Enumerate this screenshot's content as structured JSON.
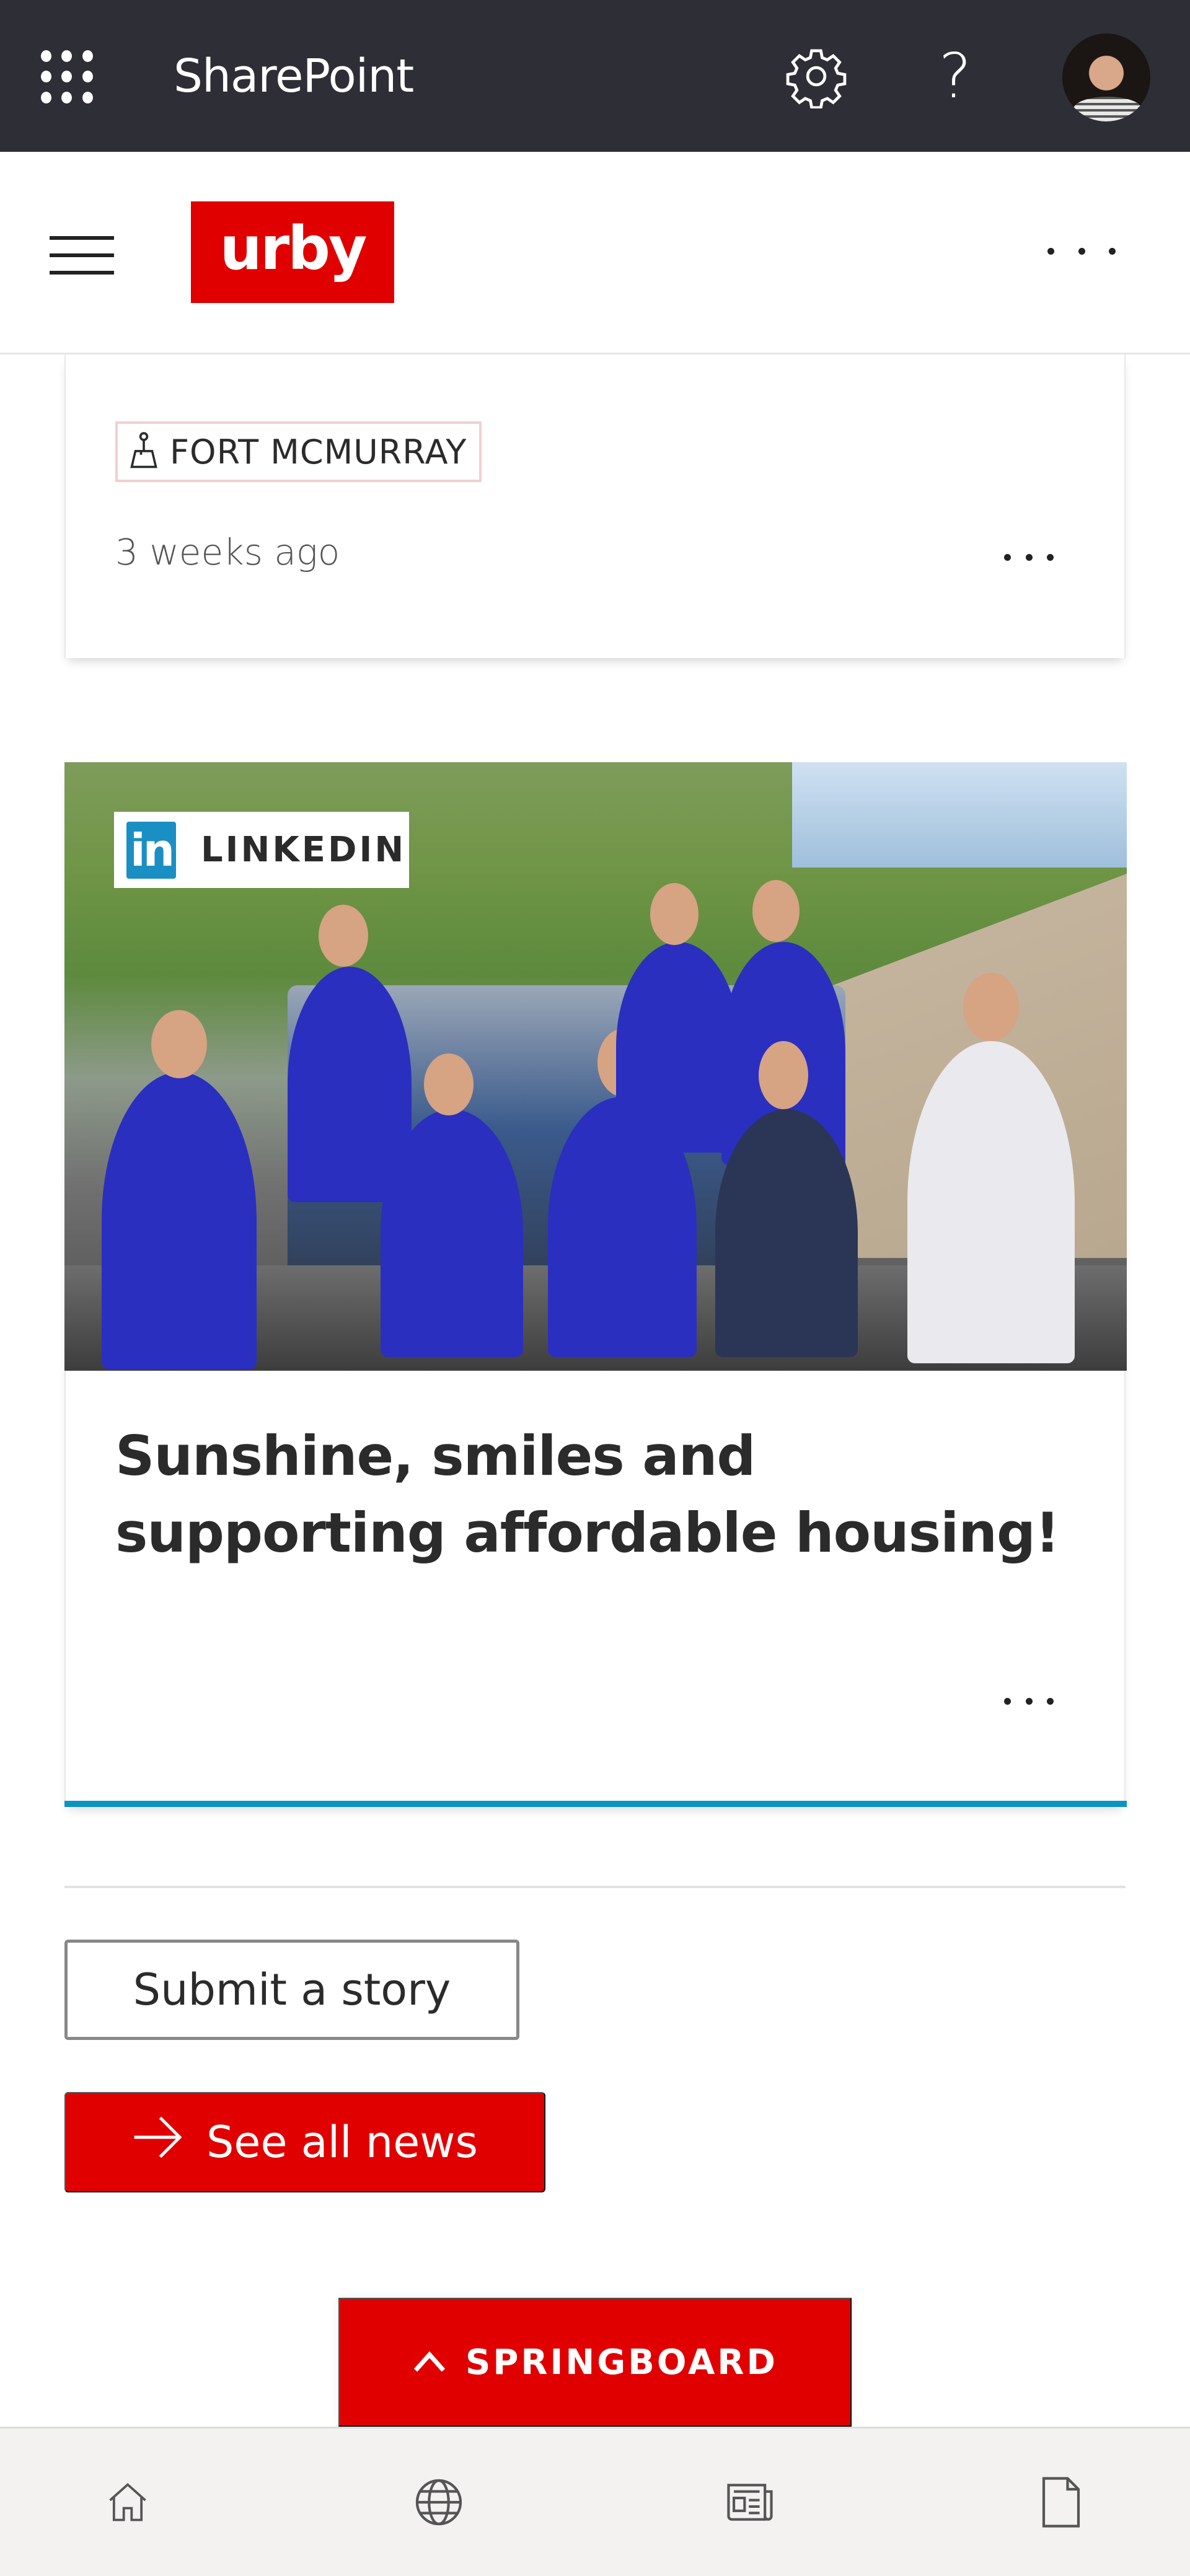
{
  "suite_bar": {
    "app_title": "SharePoint",
    "icons": [
      "app-launcher-icon",
      "settings-gear-icon",
      "help-icon",
      "user-avatar"
    ]
  },
  "site_header": {
    "logo_text": "urby",
    "menu_icon": "hamburger-menu-icon",
    "more_icon": "more-ellipsis-icon"
  },
  "news": {
    "cards": [
      {
        "tag": "FORT MCMURRAY",
        "tag_icon": "location-pin-icon",
        "date": "3 weeks ago"
      },
      {
        "source_badge": "LINKEDIN",
        "source_logo": "in",
        "image_alt": "Volunteers in blue 'every hand' shirts sitting on a pickup truck",
        "title": "Sunshine, smiles and supporting affordable housing!"
      }
    ],
    "submit_label": "Submit a story",
    "see_all_label": "See all news"
  },
  "springboard": {
    "label": "SPRINGBOARD"
  },
  "bottom_nav": {
    "items": [
      {
        "name": "home",
        "icon": "home-icon"
      },
      {
        "name": "sites",
        "icon": "globe-icon"
      },
      {
        "name": "news",
        "icon": "news-icon"
      },
      {
        "name": "files",
        "icon": "document-icon"
      }
    ]
  },
  "colors": {
    "brand_red": "#e00000",
    "suite_bar": "#2e2e36",
    "accent_blue": "#0b93c2",
    "linkedin_blue": "#1a8fc4",
    "nav_bg": "#f3f2f1"
  }
}
